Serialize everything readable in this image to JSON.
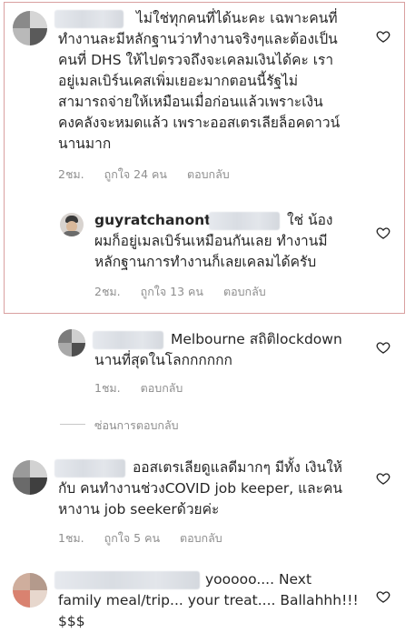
{
  "comments": [
    {
      "lines": [
        "ไม่ใช่ทุกคนที่ได้นะคะ เฉพาะคนที่",
        "ทำงานละมีหลักฐานว่าทำงานจริงๆและต้องเป็น",
        "คนที่ DHS ให้ไปตรวจถึงจะเคลมเงินได้คะ เรา",
        "อยู่เมลเบิร์นเคสเพิ่มเยอะมากตอนนี้รัฐไม่",
        "สามารถจ่ายให้เหมือนเมื่อก่อนแล้วเพราะเงิน",
        "คงคลังจะหมดแล้ว เพราะออสเตรเลียล็อคดาวน์",
        "นานมาก"
      ],
      "time": "2ชม.",
      "likes": "ถูกใจ 24 คน",
      "reply": "ตอบกลับ"
    },
    {
      "username": "guyratchanont",
      "lines": [
        "ใช่ น้อง",
        "ผมก็อยู่เมลเบิร์นเหมือนกันเลย ทำงานมี",
        "หลักฐานการทำงานก็เลยเคลมได้ครับ"
      ],
      "time": "2ชม.",
      "likes": "ถูกใจ 13 คน",
      "reply": "ตอบกลับ"
    },
    {
      "lines": [
        "Melbourne สถิติlockdown",
        "นานที่สุดในโลกกกกกก"
      ],
      "time": "1ชม.",
      "reply": "ตอบกลับ"
    },
    {
      "lines": [
        "ออสเตรเลียดูแลดีมากๆ มีทั้ง เงินให้",
        "กับ คนทำงานช่วงCOVID job keeper, และคน",
        "หางาน job seekerด้วยค่ะ"
      ],
      "time": "1ชม.",
      "likes": "ถูกใจ 5 คน",
      "reply": "ตอบกลับ"
    },
    {
      "lines": [
        "yooooo.... Next",
        "family meal/trip... your treat.... Ballahhh!!!",
        "$$$"
      ]
    }
  ],
  "hide_replies": "ซ่อนการตอบกลับ",
  "icons": {
    "like": "heart-outline-icon"
  },
  "colors": {
    "highlight_border": "#d9a0a0",
    "meta_text": "#8e8e8e"
  }
}
